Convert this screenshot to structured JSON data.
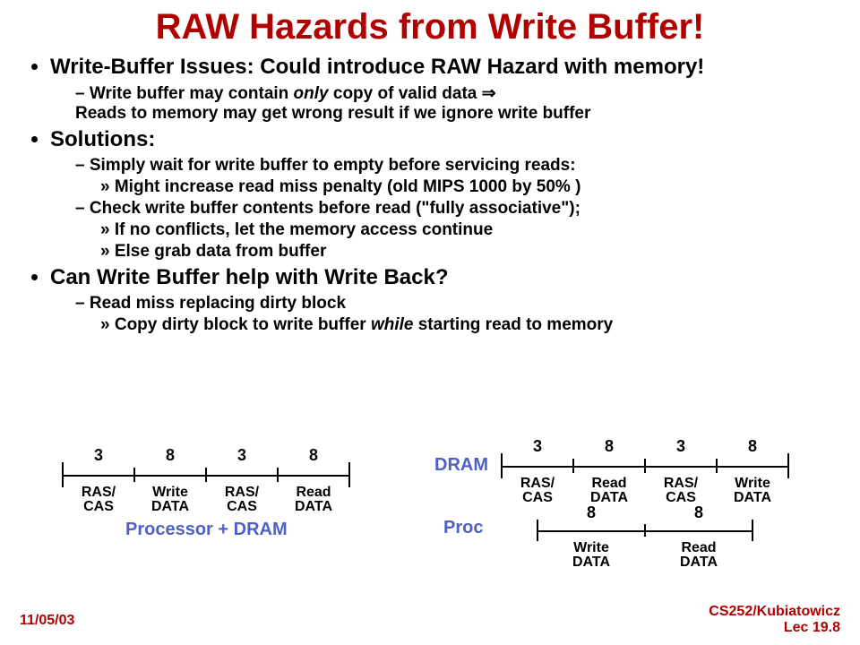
{
  "title": "RAW Hazards from Write Buffer!",
  "bullets": {
    "b1": "Write-Buffer Issues: Could introduce RAW Hazard with memory!",
    "b1a_pre": "Write buffer may contain ",
    "b1a_em": "only",
    "b1a_post": " copy of valid data ⇒",
    "b1a_line2": "Reads to memory may get wrong result if we ignore write buffer",
    "b2": "Solutions:",
    "b2a": "Simply wait for write buffer to empty before servicing reads:",
    "b2a1": "Might increase read miss penalty (old MIPS 1000 by 50% )",
    "b2b": "Check write buffer contents before read (\"fully associative\");",
    "b2b1": "If no conflicts, let the memory access continue",
    "b2b2": "Else grab data from buffer",
    "b3": "Can Write Buffer help with Write Back?",
    "b3a": "Read miss replacing dirty block",
    "b3a1_pre": "Copy dirty block to write buffer ",
    "b3a1_em": "while",
    "b3a1_post": " starting read to memory"
  },
  "diagram": {
    "left": {
      "caption": "Processor + DRAM",
      "segs": [
        {
          "n": "3",
          "lbl1": "RAS/",
          "lbl2": "CAS"
        },
        {
          "n": "8",
          "lbl1": "Write",
          "lbl2": "DATA"
        },
        {
          "n": "3",
          "lbl1": "RAS/",
          "lbl2": "CAS"
        },
        {
          "n": "8",
          "lbl1": "Read",
          "lbl2": "DATA"
        }
      ]
    },
    "right": {
      "dram_label": "DRAM",
      "proc_label": "Proc",
      "dram_segs": [
        {
          "n": "3",
          "lbl1": "RAS/",
          "lbl2": "CAS"
        },
        {
          "n": "8",
          "lbl1": "Read",
          "lbl2": "DATA"
        },
        {
          "n": "3",
          "lbl1": "RAS/",
          "lbl2": "CAS"
        },
        {
          "n": "8",
          "lbl1": "Write",
          "lbl2": "DATA"
        }
      ],
      "proc_segs": [
        {
          "n": "8",
          "lbl1": "Write",
          "lbl2": "DATA"
        },
        {
          "n": "8",
          "lbl1": "Read",
          "lbl2": "DATA"
        }
      ]
    }
  },
  "footer": {
    "left": "11/05/03",
    "right1": "CS252/Kubiatowicz",
    "right2": "Lec 19.8"
  }
}
